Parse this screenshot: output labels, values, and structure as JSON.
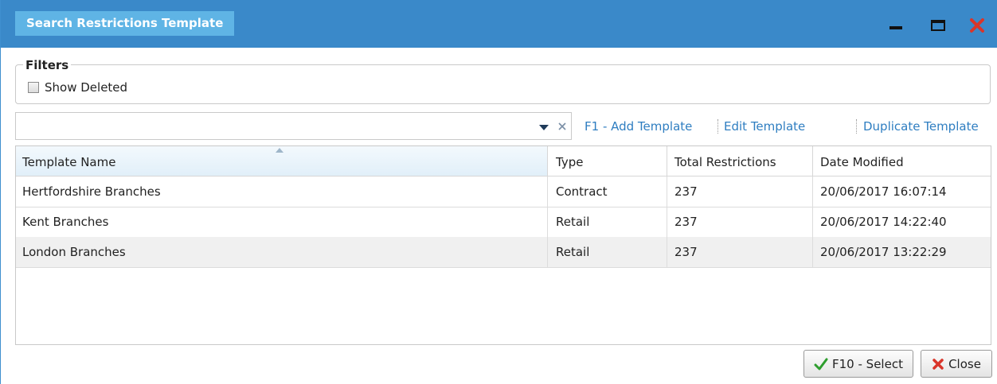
{
  "window": {
    "title": "Search Restrictions Template",
    "colors": {
      "titlebar": "#3a89c9",
      "title_tab": "#5fb4e5",
      "close": "#d9352a",
      "link": "#2f7ec1",
      "check": "#2e9e2e"
    }
  },
  "filters": {
    "legend": "Filters",
    "show_deleted_label": "Show Deleted",
    "show_deleted_checked": false
  },
  "search": {
    "value": "",
    "placeholder": ""
  },
  "toolbar": {
    "add_template": "F1 - Add Template",
    "edit_template": "Edit Template",
    "duplicate_template": "Duplicate Template"
  },
  "grid": {
    "columns": [
      "Template Name",
      "Type",
      "Total Restrictions",
      "Date Modified"
    ],
    "sorted_column": "Template Name",
    "rows": [
      {
        "name": "Hertfordshire Branches",
        "type": "Contract",
        "total": "237",
        "modified": "20/06/2017 16:07:14"
      },
      {
        "name": "Kent Branches",
        "type": "Retail",
        "total": "237",
        "modified": "20/06/2017 14:22:40"
      },
      {
        "name": "London Branches",
        "type": "Retail",
        "total": "237",
        "modified": "20/06/2017 13:22:29"
      }
    ]
  },
  "footer": {
    "select_label": "F10 - Select",
    "close_label": "Close"
  }
}
